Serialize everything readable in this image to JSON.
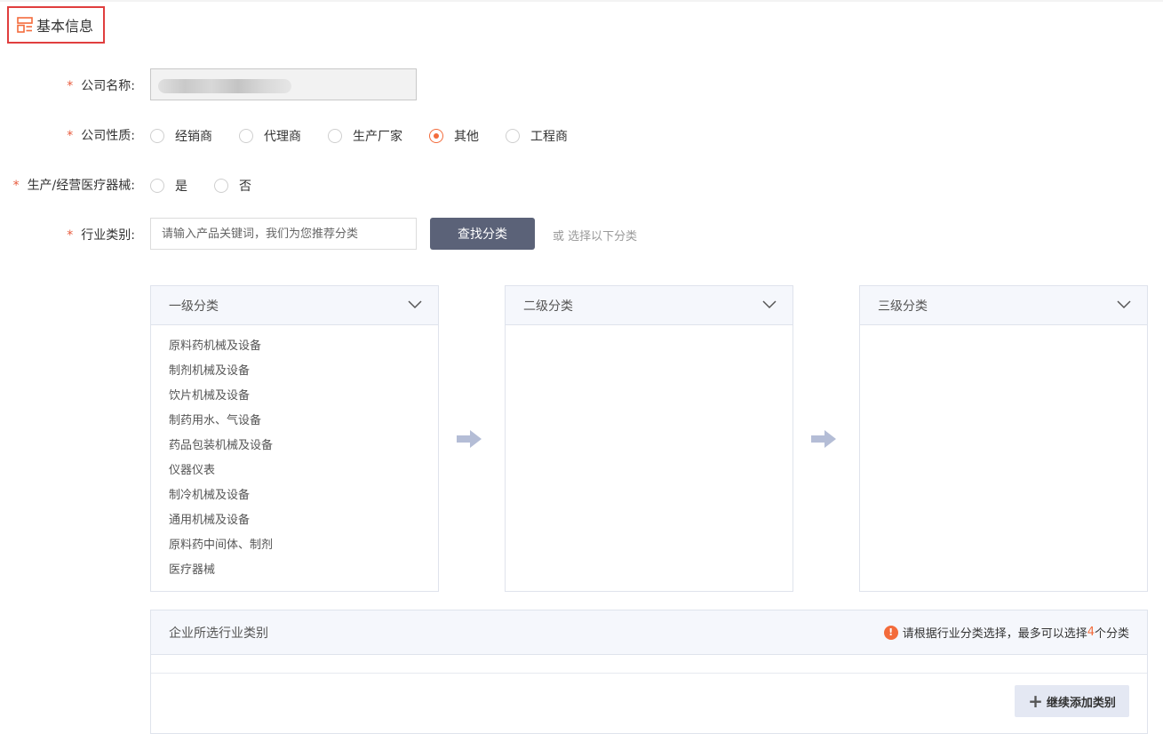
{
  "section": {
    "title": "基本信息",
    "icon": "form-layout-icon",
    "accent": "#f36b3b",
    "highlight_border": "#e03e3e"
  },
  "form": {
    "company_name": {
      "label": "公司名称:",
      "required_mark": "*",
      "value": ""
    },
    "company_type": {
      "label": "公司性质:",
      "required_mark": "*",
      "options": [
        "经销商",
        "代理商",
        "生产厂家",
        "其他",
        "工程商"
      ],
      "selected": "其他"
    },
    "medical_device": {
      "label": "生产/经营医疗器械:",
      "required_mark": "*",
      "options": [
        "是",
        "否"
      ],
      "selected": ""
    },
    "industry": {
      "label": "行业类别:",
      "required_mark": "*",
      "search_placeholder": "请输入产品关键词，我们为您推荐分类",
      "search_button": "查找分类",
      "hint": "或 选择以下分类"
    }
  },
  "categories": {
    "level1": {
      "title": "一级分类",
      "items": [
        "原料药机械及设备",
        "制剂机械及设备",
        "饮片机械及设备",
        "制药用水、气设备",
        "药品包装机械及设备",
        "仪器仪表",
        "制冷机械及设备",
        "通用机械及设备",
        "原料药中间体、制剂",
        "医疗器械"
      ]
    },
    "level2": {
      "title": "二级分类",
      "items": []
    },
    "level3": {
      "title": "三级分类",
      "items": []
    }
  },
  "selected_categories": {
    "title": "企业所选行业类别",
    "notice_prefix": "请根据行业分类选择，最多可以选择",
    "max_count": "4",
    "notice_suffix": "个分类",
    "add_button": "继续添加类别"
  },
  "colors": {
    "primary_button": "#5b6278",
    "panel_header": "#f5f7fc",
    "arrow": "#b4bdd6"
  }
}
